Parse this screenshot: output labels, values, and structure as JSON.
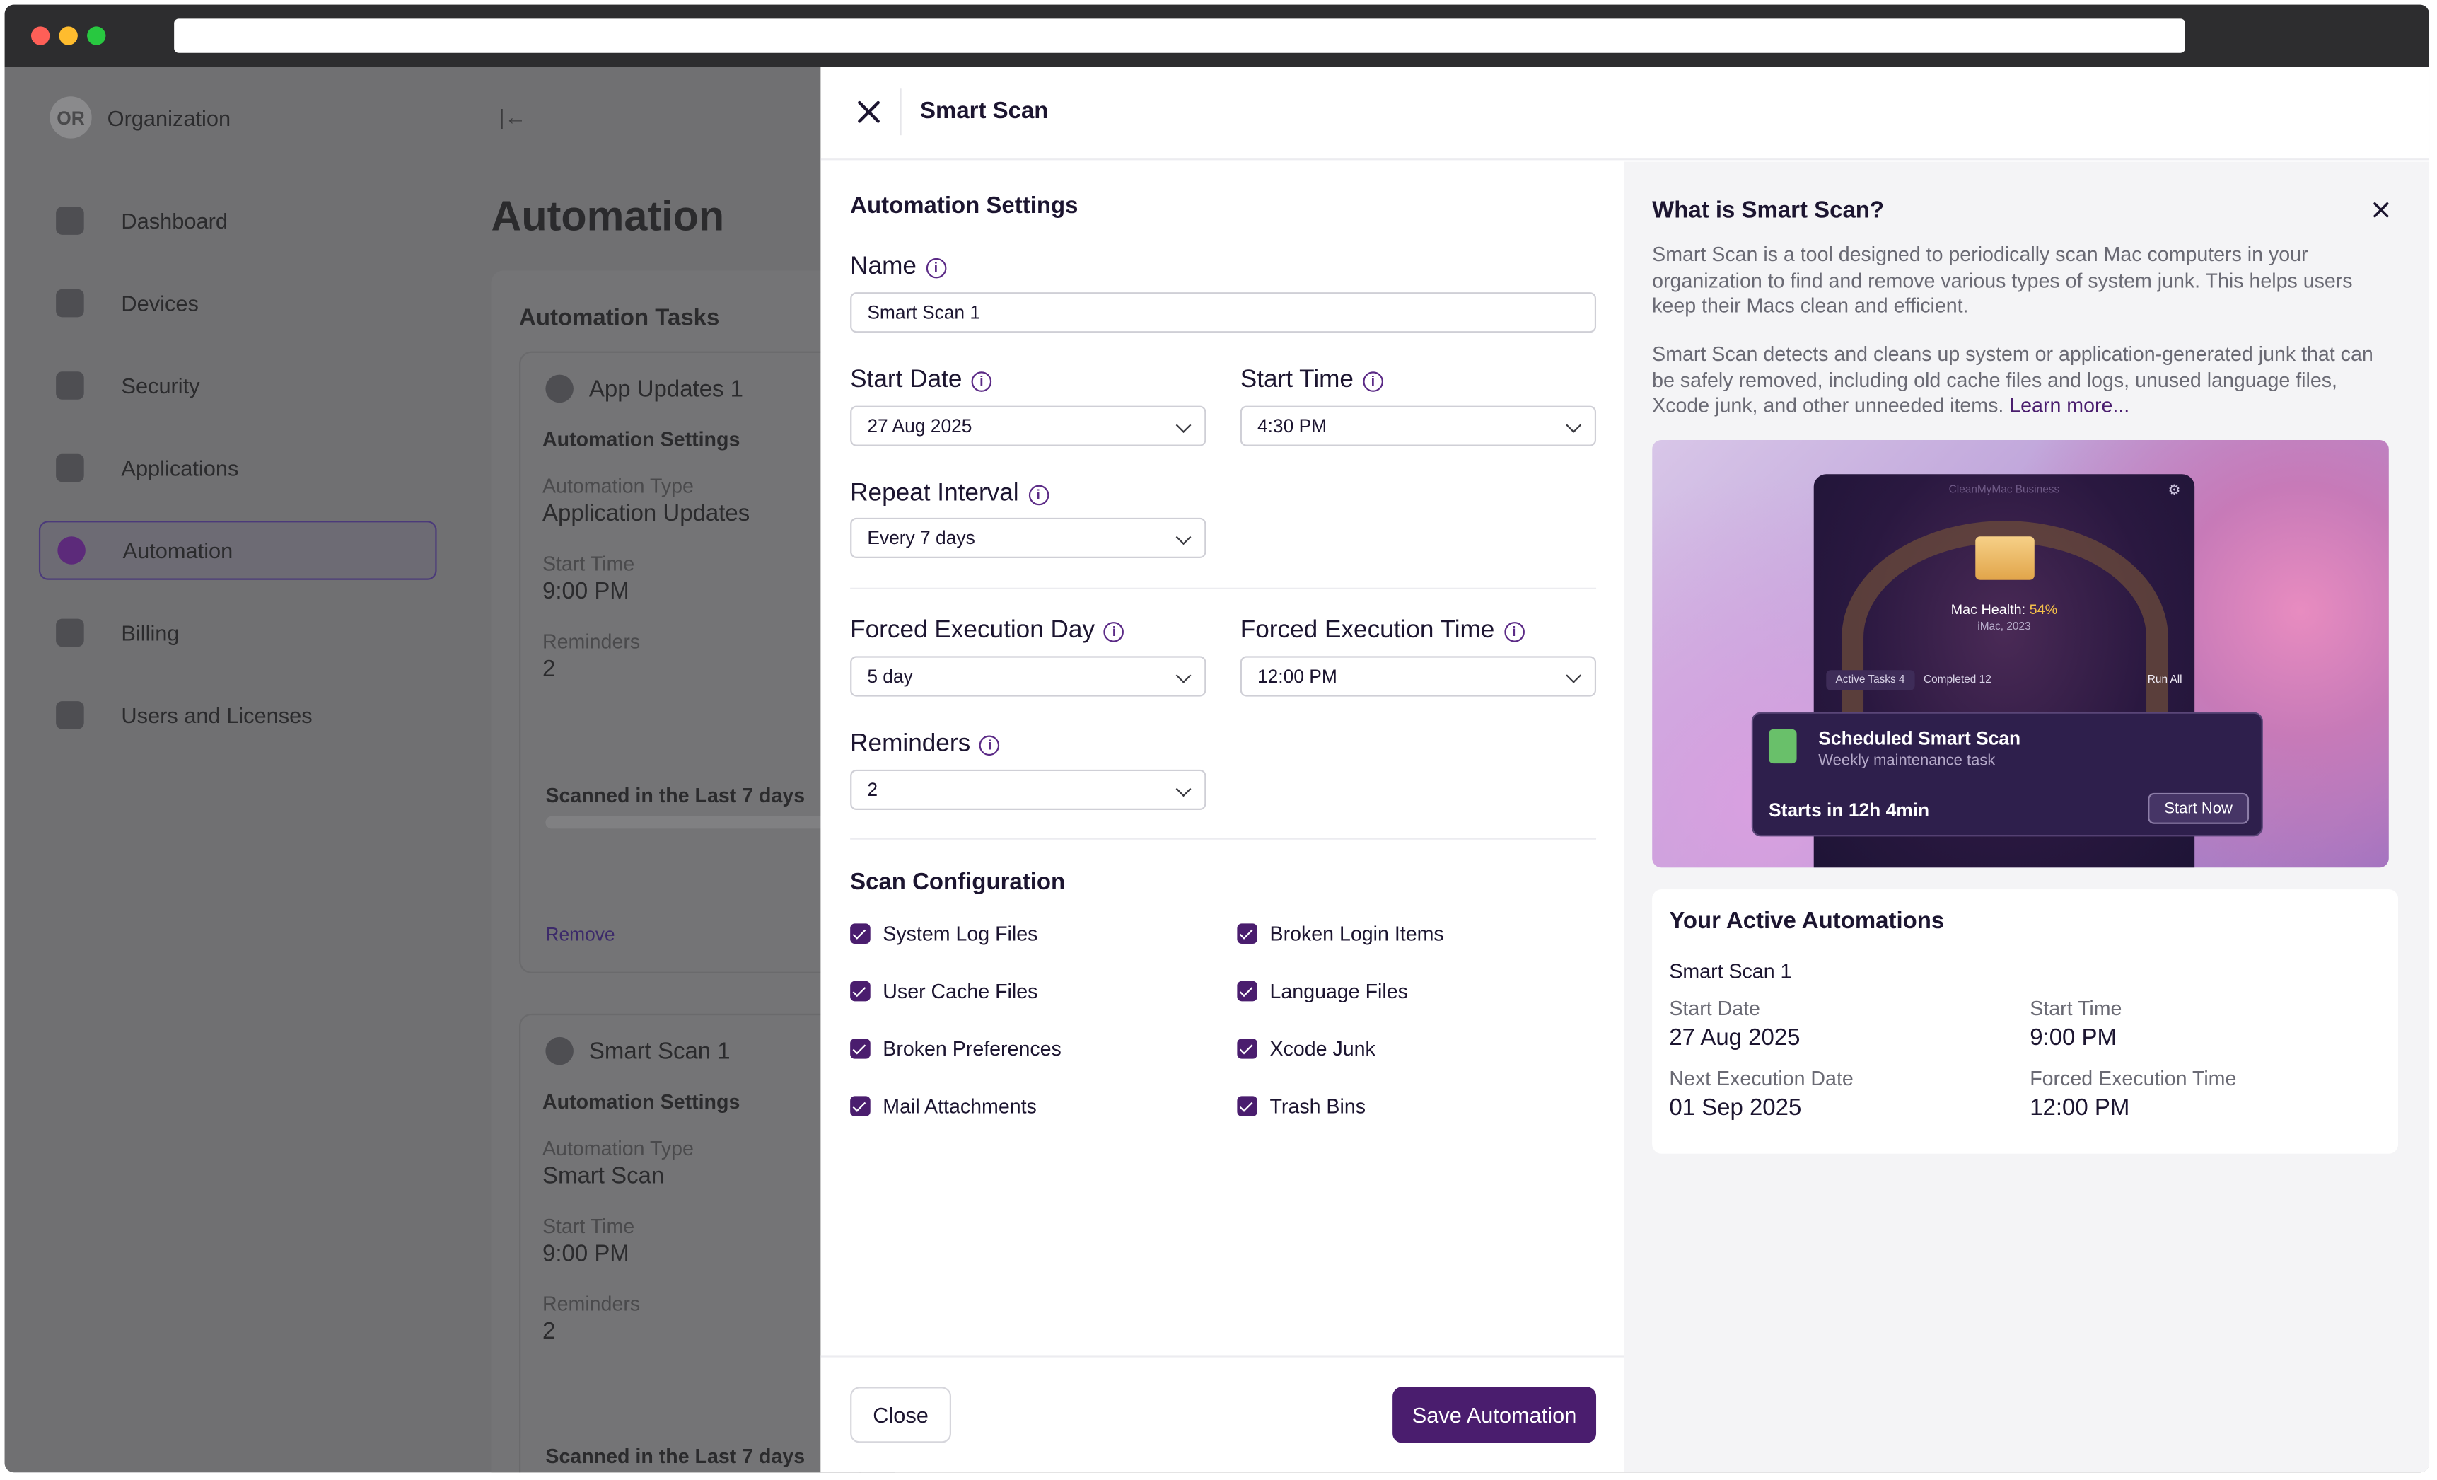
{
  "background_app": {
    "org": {
      "avatar": "OR",
      "name": "Organization"
    },
    "nav": [
      {
        "label": "Dashboard",
        "icon": "dashboard-icon"
      },
      {
        "label": "Devices",
        "icon": "devices-icon"
      },
      {
        "label": "Security",
        "icon": "shield-icon"
      },
      {
        "label": "Applications",
        "icon": "applications-icon"
      },
      {
        "label": "Automation",
        "icon": "automation-icon",
        "active": true
      },
      {
        "label": "Billing",
        "icon": "billing-icon"
      },
      {
        "label": "Users and Licenses",
        "icon": "users-icon"
      }
    ],
    "page_title": "Automation",
    "tasks_title": "Automation Tasks",
    "task1": {
      "name": "App Updates 1",
      "settings_title": "Automation Settings",
      "type_label": "Automation Type",
      "type_value": "Application Updates",
      "time_label": "Start Time",
      "time_value": "9:00 PM",
      "reminders_label": "Reminders",
      "reminders_value": "2",
      "scanned": "Scanned in the Last 7 days",
      "remove": "Remove"
    },
    "task2": {
      "name": "Smart Scan 1",
      "settings_title": "Automation Settings",
      "type_label": "Automation Type",
      "type_value": "Smart Scan",
      "time_label": "Start Time",
      "time_value": "9:00 PM",
      "reminders_label": "Reminders",
      "reminders_value": "2",
      "scanned": "Scanned in the Last 7 days"
    }
  },
  "drawer": {
    "title": "Smart Scan",
    "settings_title": "Automation Settings",
    "name": {
      "label": "Name",
      "value": "Smart Scan 1"
    },
    "start_date": {
      "label": "Start Date",
      "value": "27 Aug 2025"
    },
    "start_time": {
      "label": "Start Time",
      "value": "4:30 PM"
    },
    "repeat_interval": {
      "label": "Repeat Interval",
      "value": "Every 7 days"
    },
    "forced_day": {
      "label": "Forced Execution Day",
      "value": "5 day"
    },
    "forced_time": {
      "label": "Forced Execution Time",
      "value": "12:00 PM"
    },
    "reminders": {
      "label": "Reminders",
      "value": "2"
    },
    "scan_config_title": "Scan Configuration",
    "checks": [
      {
        "label": "System Log Files",
        "checked": true
      },
      {
        "label": "User Cache Files",
        "checked": true
      },
      {
        "label": "Broken Preferences",
        "checked": true
      },
      {
        "label": "Mail Attachments",
        "checked": true
      },
      {
        "label": "Broken Login Items",
        "checked": true
      },
      {
        "label": "Language Files",
        "checked": true
      },
      {
        "label": "Xcode Junk",
        "checked": true
      },
      {
        "label": "Trash Bins",
        "checked": true
      }
    ],
    "close_button": "Close",
    "save_button": "Save Automation"
  },
  "side": {
    "title": "What is Smart Scan?",
    "p1": "Smart Scan is a tool designed to periodically scan Mac computers in your organization to find and remove various types of system junk. This helps users keep their Macs clean and efficient.",
    "p2": "Smart Scan detects and cleans up system or application-generated junk that can be safely removed, including old cache files and logs, unused language files, Xcode junk, and other unneeded items.",
    "learn_more": "Learn more...",
    "promo": {
      "brand": "CleanMyMac Business",
      "health_label": "Mac Health:",
      "health_value": "54%",
      "device": "iMac, 2023",
      "tab_active": "Active Tasks",
      "tab_active_count": "4",
      "tab_completed": "Completed",
      "tab_completed_count": "12",
      "run_all": "Run All",
      "notif_title": "Scheduled Smart Scan",
      "notif_sub": "Weekly maintenance task",
      "notif_starts": "Starts in 12h 4min",
      "notif_button": "Start Now"
    },
    "active": {
      "title": "Your Active Automations",
      "name": "Smart Scan 1",
      "start_date_label": "Start Date",
      "start_date": "27 Aug 2025",
      "start_time_label": "Start Time",
      "start_time": "9:00 PM",
      "next_label": "Next Execution Date",
      "next": "01 Sep 2025",
      "forced_label": "Forced Execution Time",
      "forced": "12:00 PM"
    }
  },
  "colors": {
    "accent": "#4a1d6e",
    "overlay": "#707072"
  }
}
